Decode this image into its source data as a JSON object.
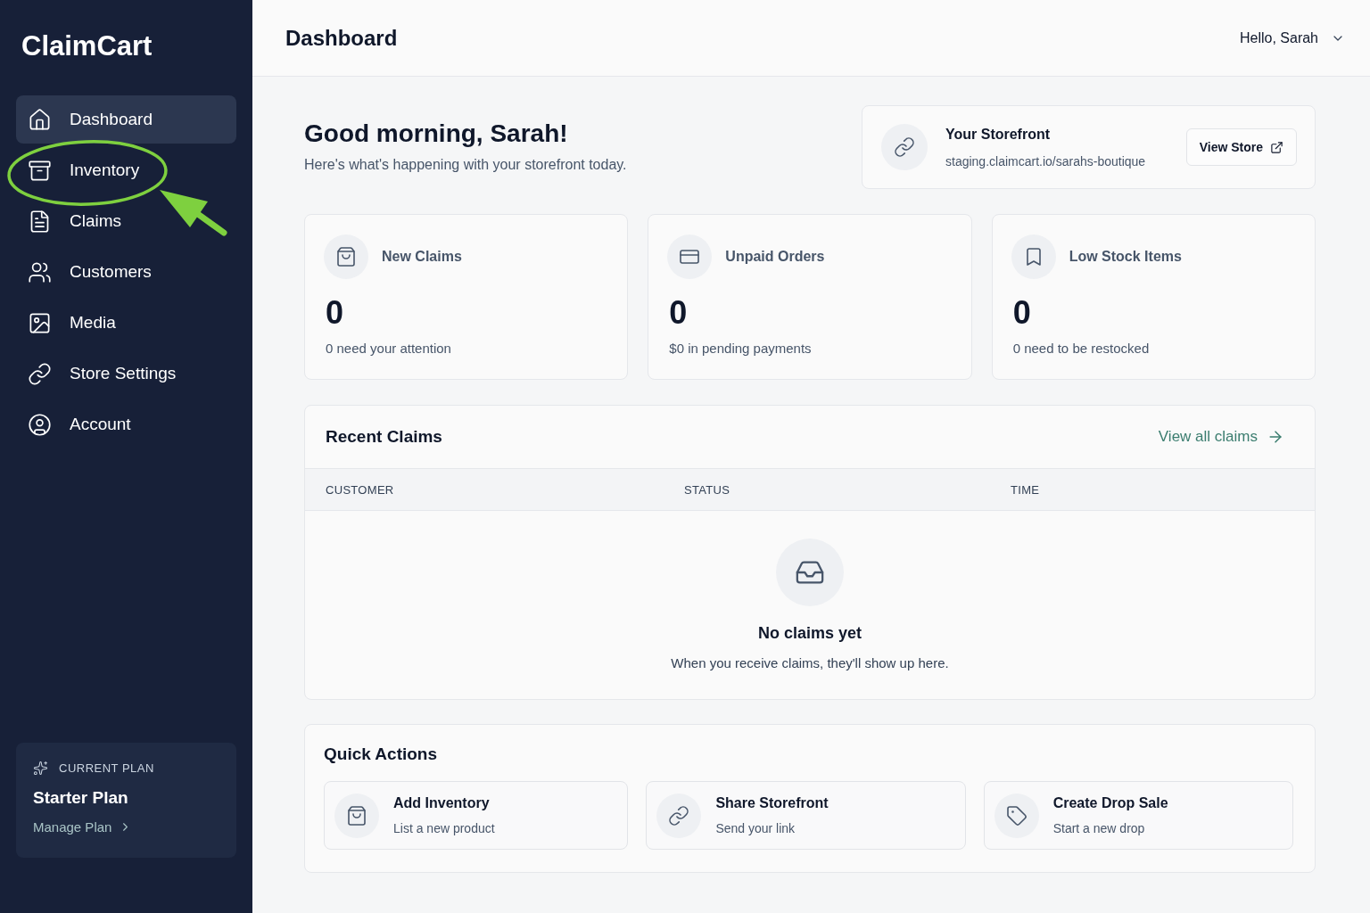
{
  "sidebar": {
    "logo": "ClaimCart",
    "items": [
      {
        "label": "Dashboard",
        "selected": true,
        "highlighted": false
      },
      {
        "label": "Inventory",
        "selected": false,
        "highlighted": true
      },
      {
        "label": "Claims",
        "selected": false,
        "highlighted": false
      },
      {
        "label": "Customers",
        "selected": false,
        "highlighted": false
      },
      {
        "label": "Media",
        "selected": false,
        "highlighted": false
      },
      {
        "label": "Store Settings",
        "selected": false,
        "highlighted": false
      },
      {
        "label": "Account",
        "selected": false,
        "highlighted": false
      }
    ],
    "plan": {
      "eyebrow": "CURRENT PLAN",
      "name": "Starter Plan",
      "link": "Manage Plan"
    }
  },
  "header": {
    "title": "Dashboard",
    "user": "Hello, Sarah"
  },
  "greeting": {
    "title": "Good morning, Sarah!",
    "subtitle": "Here's what's happening with your storefront today."
  },
  "storefront": {
    "title": "Your Storefront",
    "url": "staging.claimcart.io/sarahs-boutique",
    "button": "View Store"
  },
  "stats": [
    {
      "label": "New Claims",
      "value": "0",
      "note": "0 need your attention"
    },
    {
      "label": "Unpaid Orders",
      "value": "0",
      "note": "$0 in pending payments"
    },
    {
      "label": "Low Stock Items",
      "value": "0",
      "note": "0 need to be restocked"
    }
  ],
  "recent_claims": {
    "title": "Recent Claims",
    "link": "View all claims",
    "columns": [
      "CUSTOMER",
      "STATUS",
      "TIME"
    ],
    "empty": {
      "title": "No claims yet",
      "text": "When you receive claims, they'll show up here."
    }
  },
  "quick_actions": {
    "title": "Quick Actions",
    "items": [
      {
        "title": "Add Inventory",
        "subtitle": "List a new product"
      },
      {
        "title": "Share Storefront",
        "subtitle": "Send your link"
      },
      {
        "title": "Create Drop Sale",
        "subtitle": "Start a new drop"
      }
    ]
  }
}
